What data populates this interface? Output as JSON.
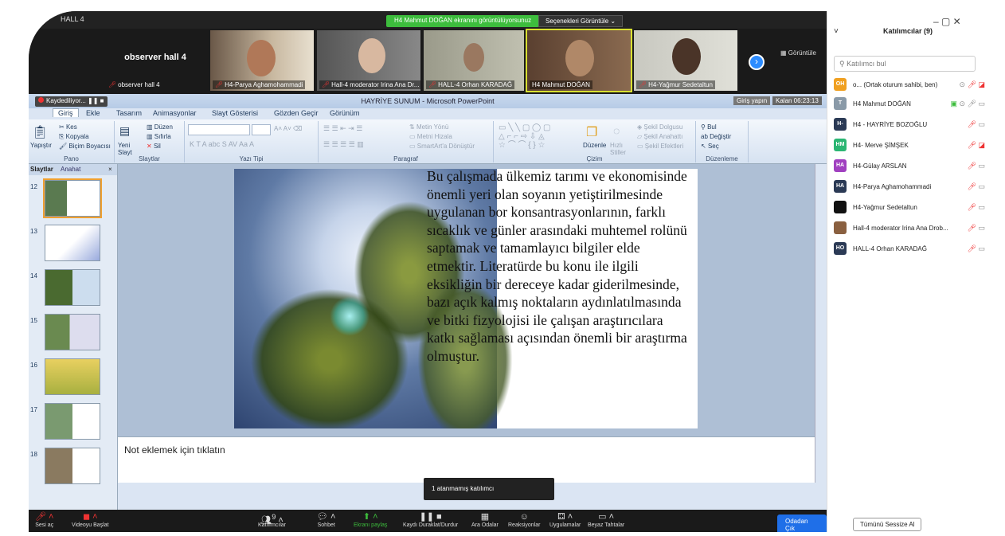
{
  "meeting": {
    "window_title": "HALL 4",
    "share_banner": "H4 Mahmut DOĞAN ekranını görüntülüyorsunuz",
    "view_options": "Seçenekleri Görüntüle",
    "view_button": "Görüntüle",
    "gallery": [
      {
        "name": "observer hall 4",
        "big": "observer hall 4"
      },
      {
        "name": "H4-Parya Aghamohammadi"
      },
      {
        "name": "Hall-4 moderator Irina Ana Dr..."
      },
      {
        "name": "HALL-4 Orhan KARADAĞ"
      },
      {
        "name": "H4 Mahmut DOĞAN"
      },
      {
        "name": "H4-Yağmur Sedetaltun"
      }
    ]
  },
  "ppt": {
    "title": "HAYRİYE SUNUM - Microsoft PowerPoint",
    "recording": "Kaydediliyor...",
    "giris": "Giriş yapın",
    "kalan": "Kalan 06:23:13",
    "tabs": [
      "Giriş",
      "Ekle",
      "Tasarım",
      "Animasyonlar",
      "Slayt Gösterisi",
      "Gözden Geçir",
      "Görünüm"
    ],
    "ribbon": {
      "pano": {
        "label": "Pano",
        "paste": "Yapıştır",
        "cut": "Kes",
        "copy": "Kopyala",
        "format": "Biçim Boyacısı"
      },
      "slaytlar": {
        "label": "Slaytlar",
        "new": "Yeni Slayt",
        "layout": "Düzen",
        "reset": "Sıfırla",
        "delete": "Sil"
      },
      "yazi": {
        "label": "Yazı Tipi"
      },
      "paragraf": {
        "label": "Paragraf",
        "dir": "Metin Yönü",
        "align": "Metni Hizala",
        "smart": "SmartArt'a Dönüştür"
      },
      "cizim": {
        "label": "Çizim",
        "arrange": "Düzenle",
        "quick": "Hızlı Stiller",
        "fill": "Şekil Dolgusu",
        "outline": "Şekil Anahattı",
        "effects": "Şekil Efektleri"
      },
      "duzenleme": {
        "label": "Düzenleme",
        "find": "Bul",
        "replace": "Değiştir",
        "select": "Seç"
      }
    },
    "left_tabs": [
      "Slaytlar",
      "Anahat"
    ],
    "slide_numbers": [
      "12",
      "13",
      "14",
      "15",
      "16",
      "17",
      "18"
    ],
    "slide_text": "Bu çalışmada ülkemiz tarımı ve ekonomisinde önemli yeri olan soyanın yetiştirilmesinde uygulanan bor konsantrasyonlarının, farklı sıcaklık ve günler arasındaki muhtemel rolünü saptamak ve tamamlayıcı bilgiler elde etmektir. Literatürde bu konu ile ilgili eksikliğin bir dereceye kadar giderilmesinde, bazı açık kalmış noktaların aydınlatılmasında ve bitki fizyolojisi ile çalışan araştırıcılara katkı sağlaması açısından önemli bir araştırma olmuştur.",
    "notes_placeholder": "Not eklemek için tıklatın"
  },
  "tooltip": "1 atanmamış katılımcı",
  "toolbar": {
    "mute": "Sesi aç",
    "video": "Videoyu Başlat",
    "participants": "Katılımcılar",
    "participants_count": "9",
    "chat": "Sohbet",
    "share": "Ekranı paylaş",
    "record": "Kaydı Duraklat/Durdur",
    "rooms": "Ara Odalar",
    "reactions": "Reaksiyonlar",
    "apps": "Uygulamalar",
    "whiteboard": "Beyaz Tahtalar",
    "leave": "Odadan Çık"
  },
  "panel": {
    "title": "Katılımcılar (9)",
    "search_placeholder": "Katılımcı bul",
    "mute_all": "Tümünü Sessize Al",
    "participants": [
      {
        "initials": "OH",
        "name": "o... (Ortak oturum sahibi, ben)",
        "color": "#f0a020"
      },
      {
        "initials": "T",
        "name": "H4 Mahmut DOĞAN",
        "color": "#8a9aa8"
      },
      {
        "initials": "H-",
        "name": "H4 - HAYRİYE BOZOĞLU",
        "color": "#2b3a55"
      },
      {
        "initials": "HM",
        "name": "H4- Merve ŞİMŞEK",
        "color": "#2bb673"
      },
      {
        "initials": "HA",
        "name": "H4-Gülay ARSLAN",
        "color": "#a040c0"
      },
      {
        "initials": "HA",
        "name": "H4-Parya Aghamohammadi",
        "color": "#2b3a55"
      },
      {
        "initials": "",
        "name": "H4-Yağmur Sedetaltun",
        "color": "#111111"
      },
      {
        "initials": "",
        "name": "Hall-4 moderator Irina Ana Drob...",
        "color": "#8a6040"
      },
      {
        "initials": "HO",
        "name": "HALL-4 Orhan KARADAĞ",
        "color": "#2b3a55"
      }
    ]
  },
  "window_controls": "–   ▢   ✕"
}
